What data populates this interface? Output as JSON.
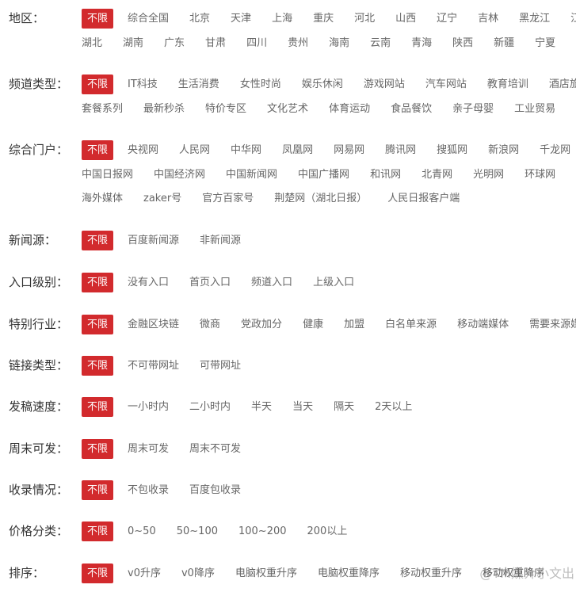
{
  "rows": [
    {
      "label": "地区：",
      "badge": "不限",
      "lines": [
        [
          "综合全国",
          "北京",
          "天津",
          "上海",
          "重庆",
          "河北",
          "山西",
          "辽宁",
          "吉林",
          "黑龙江",
          "江"
        ],
        [
          "湖北",
          "湖南",
          "广东",
          "甘肃",
          "四川",
          "贵州",
          "海南",
          "云南",
          "青海",
          "陕西",
          "新疆",
          "宁夏"
        ]
      ]
    },
    {
      "label": "频道类型：",
      "badge": "不限",
      "lines": [
        [
          "IT科技",
          "生活消费",
          "女性时尚",
          "娱乐休闲",
          "游戏网站",
          "汽车网站",
          "教育培训",
          "酒店旅"
        ],
        [
          "套餐系列",
          "最新秒杀",
          "特价专区",
          "文化艺术",
          "体育运动",
          "食品餐饮",
          "亲子母婴",
          "工业贸易"
        ]
      ]
    },
    {
      "label": "综合门户：",
      "badge": "不限",
      "lines": [
        [
          "央视网",
          "人民网",
          "中华网",
          "凤凰网",
          "网易网",
          "腾讯网",
          "搜狐网",
          "新浪网",
          "千龙网"
        ],
        [
          "中国日报网",
          "中国经济网",
          "中国新闻网",
          "中国广播网",
          "和讯网",
          "北青网",
          "光明网",
          "环球网"
        ],
        [
          "海外媒体",
          "zaker号",
          "官方百家号",
          "荆楚网（湖北日报）",
          "人民日报客户端"
        ]
      ]
    },
    {
      "label": "新闻源：",
      "badge": "不限",
      "lines": [
        [
          "百度新闻源",
          "非新闻源"
        ]
      ]
    },
    {
      "label": "入口级别：",
      "badge": "不限",
      "lines": [
        [
          "没有入口",
          "首页入口",
          "频道入口",
          "上级入口"
        ]
      ]
    },
    {
      "label": "特别行业：",
      "badge": "不限",
      "lines": [
        [
          "金融区块链",
          "微商",
          "党政加分",
          "健康",
          "加盟",
          "白名单来源",
          "移动端媒体",
          "需要来源媒"
        ]
      ]
    },
    {
      "label": "链接类型：",
      "badge": "不限",
      "lines": [
        [
          "不可带网址",
          "可带网址"
        ]
      ]
    },
    {
      "label": "发稿速度：",
      "badge": "不限",
      "lines": [
        [
          "一小时内",
          "二小时内",
          "半天",
          "当天",
          "隔天",
          "2天以上"
        ]
      ]
    },
    {
      "label": "周末可发：",
      "badge": "不限",
      "lines": [
        [
          "周末可发",
          "周末不可发"
        ]
      ]
    },
    {
      "label": "收录情况：",
      "badge": "不限",
      "lines": [
        [
          "不包收录",
          "百度包收录"
        ]
      ]
    },
    {
      "label": "价格分类：",
      "badge": "不限",
      "lines": [
        [
          "0~50",
          "50~100",
          "100~200",
          "200以上"
        ]
      ]
    },
    {
      "label": "排序：",
      "badge": "不限",
      "lines": [
        [
          "v0升序",
          "v0降序",
          "电脑权重升序",
          "电脑权重降序",
          "移动权重升序",
          "移动权重降序"
        ]
      ]
    }
  ],
  "watermark": "@TM媒介小文出",
  "colors": {
    "badge_bg": "#d22a2d",
    "label": "#333333",
    "option": "#666666"
  }
}
